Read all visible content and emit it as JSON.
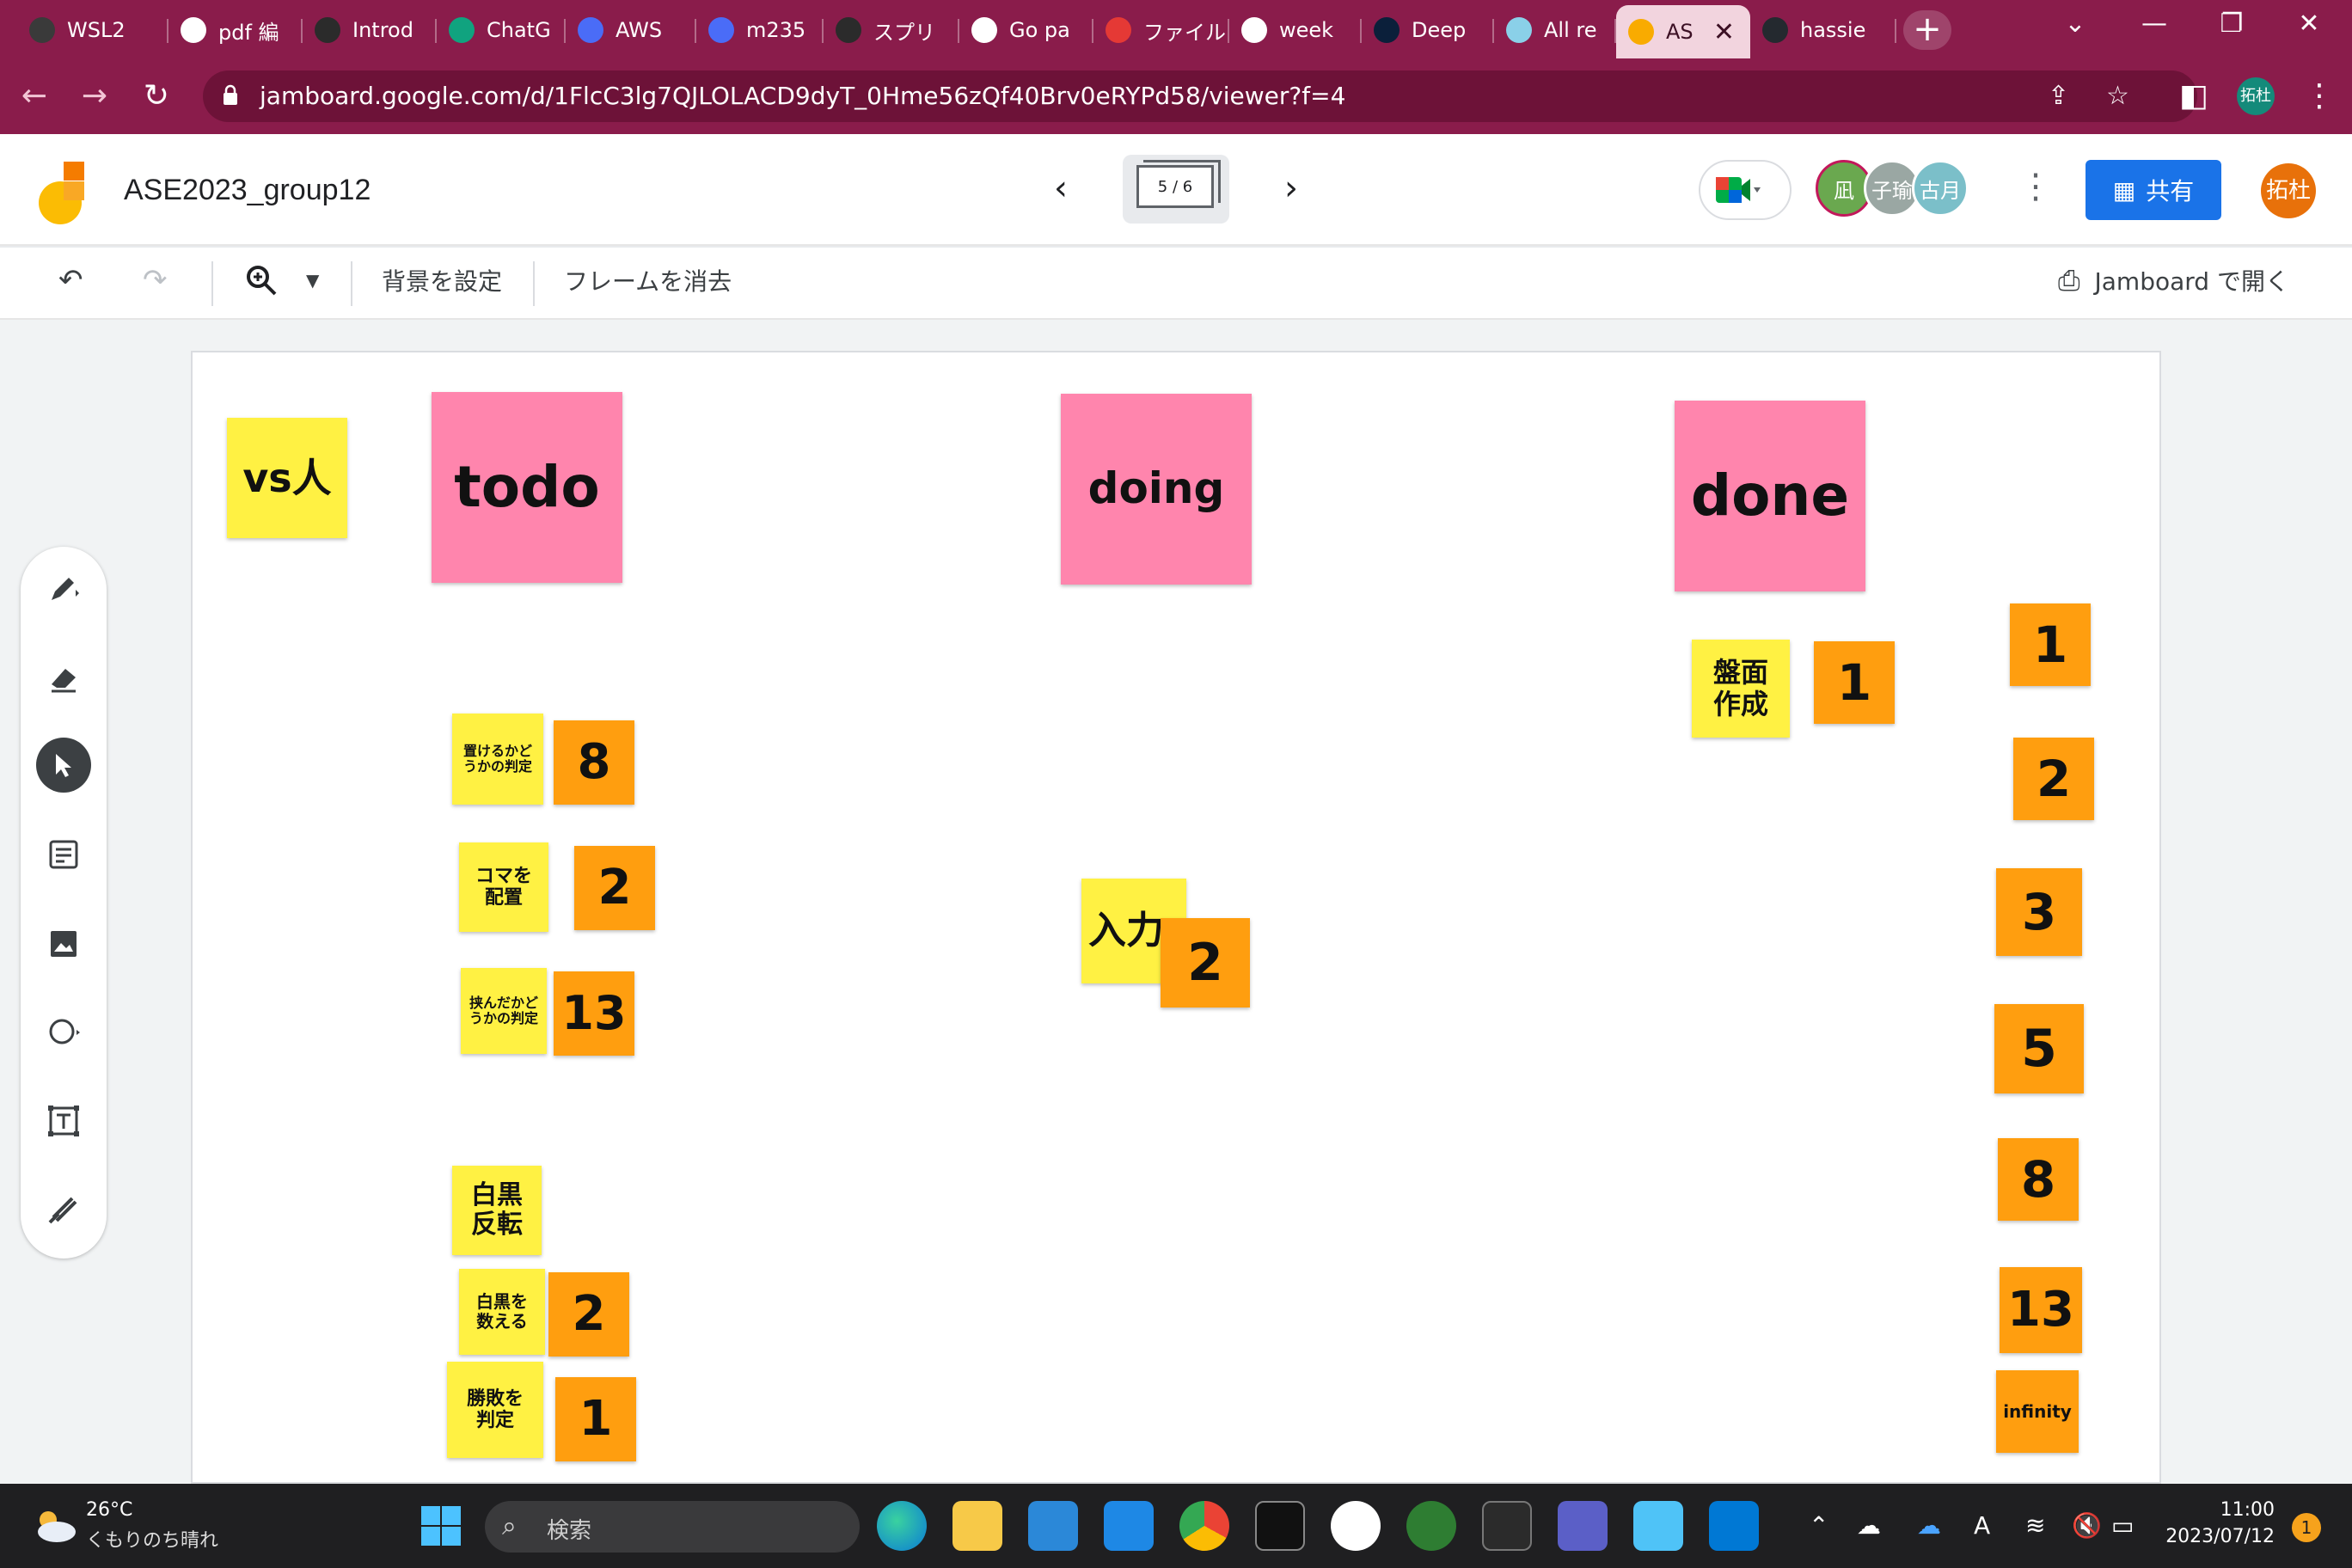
{
  "browser": {
    "tabs": [
      {
        "label": "WSL2",
        "fav_color": "#3a3a3a"
      },
      {
        "label": "pdf 編",
        "fav_color": "#ffffff"
      },
      {
        "label": "Introd",
        "fav_color": "#2b2b2b"
      },
      {
        "label": "ChatG",
        "fav_color": "#10a37f"
      },
      {
        "label": "AWS",
        "fav_color": "#4a6cf7"
      },
      {
        "label": "m235",
        "fav_color": "#4a6cf7"
      },
      {
        "label": "スプリ",
        "fav_color": "#2b2b2b"
      },
      {
        "label": "Go pa",
        "fav_color": "#ffffff"
      },
      {
        "label": "ファイル",
        "fav_color": "#e53935"
      },
      {
        "label": "week",
        "fav_color": "#ffffff"
      },
      {
        "label": "Deep",
        "fav_color": "#0b1f3a"
      },
      {
        "label": "All re",
        "fav_color": "#8ad0e8"
      },
      {
        "label": "AS",
        "fav_color": "#f9ab00"
      },
      {
        "label": "hassie",
        "fav_color": "#24292f"
      }
    ],
    "url": "jamboard.google.com/d/1FlcC3lg7QJLOLACD9dyT_0Hme56zQf40Brv0eRYPd58/viewer?f=4",
    "profile": "拓杜"
  },
  "app": {
    "title": "ASE2023_group12",
    "frame_counter": "5 / 6",
    "collaborators": [
      {
        "initial": "凪",
        "color": "#6aa84f"
      },
      {
        "initial": "子瑜",
        "color": "#9aa7a3"
      },
      {
        "initial": "古月",
        "color": "#7bbfc9"
      }
    ],
    "share_label": "共有",
    "me_avatar": "拓杜"
  },
  "toolbar": {
    "background_label": "背景を設定",
    "clear_frame_label": "フレームを消去",
    "open_jamboard_label": "Jamboard で開く"
  },
  "notes": {
    "vs_human": "vs人",
    "todo": "todo",
    "doing": "doing",
    "done": "done",
    "todo_items": [
      {
        "text": "置けるかど\nうかの判定",
        "points": "8"
      },
      {
        "text": "コマを\n配置",
        "points": "2"
      },
      {
        "text": "挟んだかど\nうかの判定",
        "points": "13"
      },
      {
        "text": "白黒\n反転",
        "points": ""
      },
      {
        "text": "白黒を\n数える",
        "points": "2"
      },
      {
        "text": "勝敗を\n判定",
        "points": "1"
      }
    ],
    "doing_items": [
      {
        "text": "入力",
        "points": "2"
      }
    ],
    "done_items": [
      {
        "text": "盤面\n作成",
        "points": "1"
      }
    ],
    "scale": [
      "1",
      "2",
      "3",
      "5",
      "8",
      "13",
      "infinity"
    ]
  },
  "taskbar": {
    "weather_temp": "26°C",
    "weather_desc": "くもりのち晴れ",
    "search_placeholder": "検索",
    "time": "11:00",
    "date": "2023/07/12",
    "notifications": "1"
  }
}
